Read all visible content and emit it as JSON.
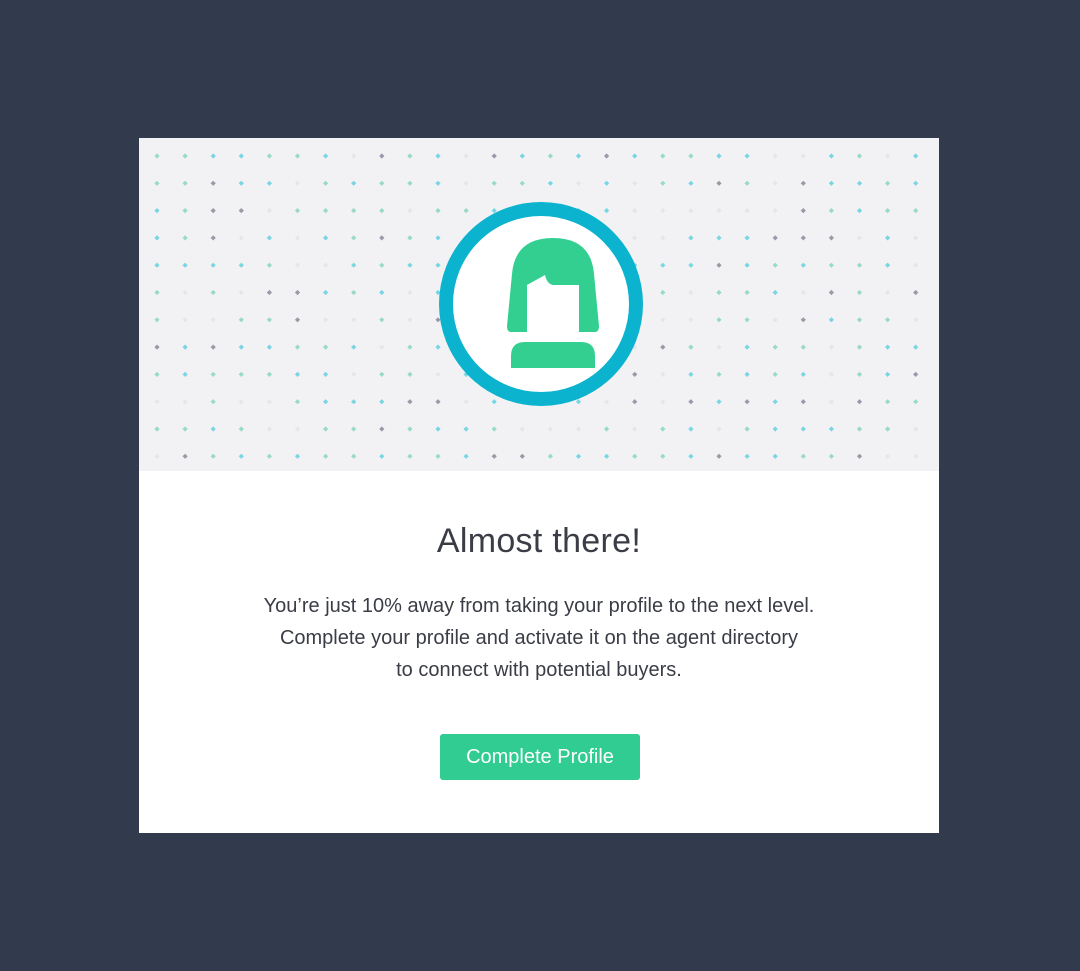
{
  "card": {
    "title": "Almost there!",
    "message_lines": [
      "You’re just 10% away from taking your profile to the next level.",
      "Complete your profile and activate it on the agent directory",
      "to connect with potential buyers."
    ],
    "cta_label": "Complete Profile",
    "remaining_percent": 10
  },
  "hero": {
    "avatar_icon": "female-user-icon",
    "pattern": "diamond-dots"
  },
  "colors": {
    "page_background": "#323a4d",
    "card_background": "#ffffff",
    "hero_background": "#f2f2f4",
    "ring": "#0bb3cf",
    "avatar": "#33cf90",
    "button": "#30cc91",
    "dot_palette": [
      "#78d6e3",
      "#97dcc0",
      "#9b99a8",
      "#e6e6ea"
    ]
  }
}
